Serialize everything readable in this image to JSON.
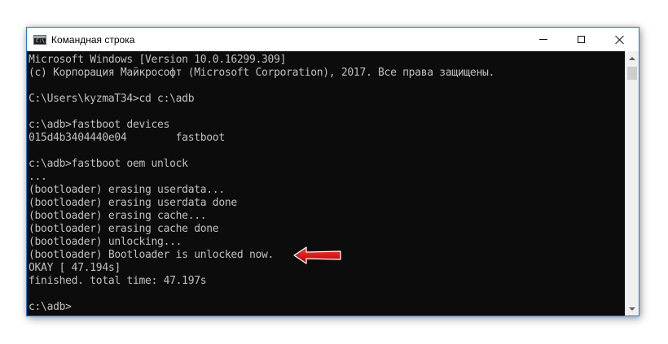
{
  "window": {
    "title": "Командная строка",
    "icon": "cmd-app-icon",
    "icon_text": "C:\\."
  },
  "controls": {
    "minimize": "minimize-icon",
    "maximize": "maximize-icon",
    "close": "close-icon"
  },
  "console": {
    "lines": [
      "Microsoft Windows [Version 10.0.16299.309]",
      "(с) Корпорация Майкрософт (Microsoft Corporation), 2017. Все права защищены.",
      "",
      "C:\\Users\\kyzmaT34>cd c:\\adb",
      "",
      "c:\\adb>fastboot devices",
      "015d4b3404440e04        fastboot",
      "",
      "c:\\adb>fastboot oem unlock",
      "...",
      "(bootloader) erasing userdata...",
      "(bootloader) erasing userdata done",
      "(bootloader) erasing cache...",
      "(bootloader) erasing cache done",
      "(bootloader) unlocking...",
      "(bootloader) Bootloader is unlocked now.",
      "OKAY [ 47.194s]",
      "finished. total time: 47.197s",
      "",
      "c:\\adb>"
    ]
  },
  "annotation": {
    "arrow_color": "#d40000",
    "arrow_icon": "red-arrow-icon"
  },
  "colors": {
    "console_bg": "#0c0c0c",
    "console_text": "#c0c0c0",
    "window_border": "#2b78c9"
  }
}
